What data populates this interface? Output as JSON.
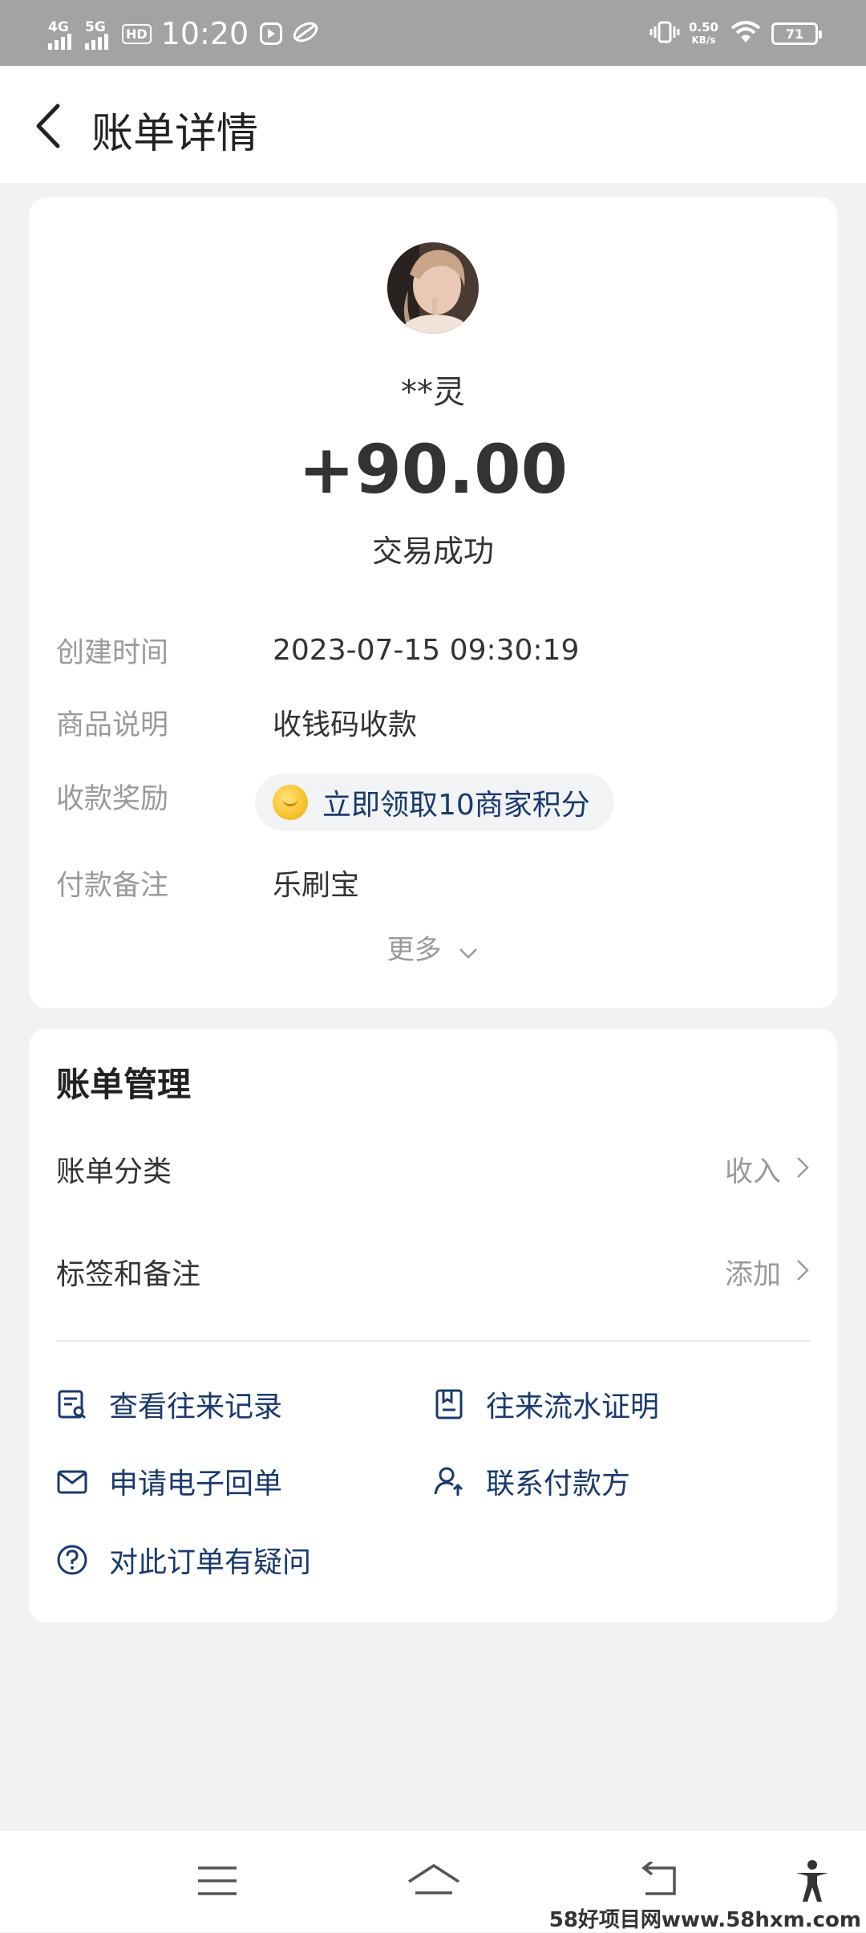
{
  "status_bar": {
    "signal_1": "4G",
    "signal_2": "5G",
    "hd_badge": "HD",
    "time": "10:20",
    "net_speed_value": "0.50",
    "net_speed_unit": "KB/s",
    "battery": "71",
    "icons": [
      "play-icon",
      "leaf-icon",
      "vibrate-icon",
      "wifi-icon",
      "battery-icon"
    ]
  },
  "header": {
    "title": "账单详情"
  },
  "transaction": {
    "payer": "**灵",
    "amount": "+90.00",
    "status": "交易成功",
    "rows": [
      {
        "label": "创建时间",
        "value": "2023-07-15 09:30:19"
      },
      {
        "label": "商品说明",
        "value": "收钱码收款"
      },
      {
        "label": "收款奖励",
        "value": "立即领取10商家积分"
      },
      {
        "label": "付款备注",
        "value": "乐刷宝"
      }
    ],
    "more": "更多"
  },
  "manage": {
    "title": "账单管理",
    "rows": [
      {
        "label": "账单分类",
        "value": "收入"
      },
      {
        "label": "标签和备注",
        "value": "添加"
      }
    ],
    "links": [
      {
        "label": "查看往来记录",
        "icon": "records-icon"
      },
      {
        "label": "往来流水证明",
        "icon": "statement-proof-icon"
      },
      {
        "label": "申请电子回单",
        "icon": "envelope-icon"
      },
      {
        "label": "联系付款方",
        "icon": "contact-person-icon"
      },
      {
        "label": "对此订单有疑问",
        "icon": "question-icon"
      }
    ]
  },
  "watermark": "58好项目网www.58hxm.com",
  "colors": {
    "link_blue": "#1a3a6e",
    "label_gray": "#9a9a9a",
    "page_bg": "#f2f2f4",
    "status_bar_bg": "#a3a3a3"
  }
}
